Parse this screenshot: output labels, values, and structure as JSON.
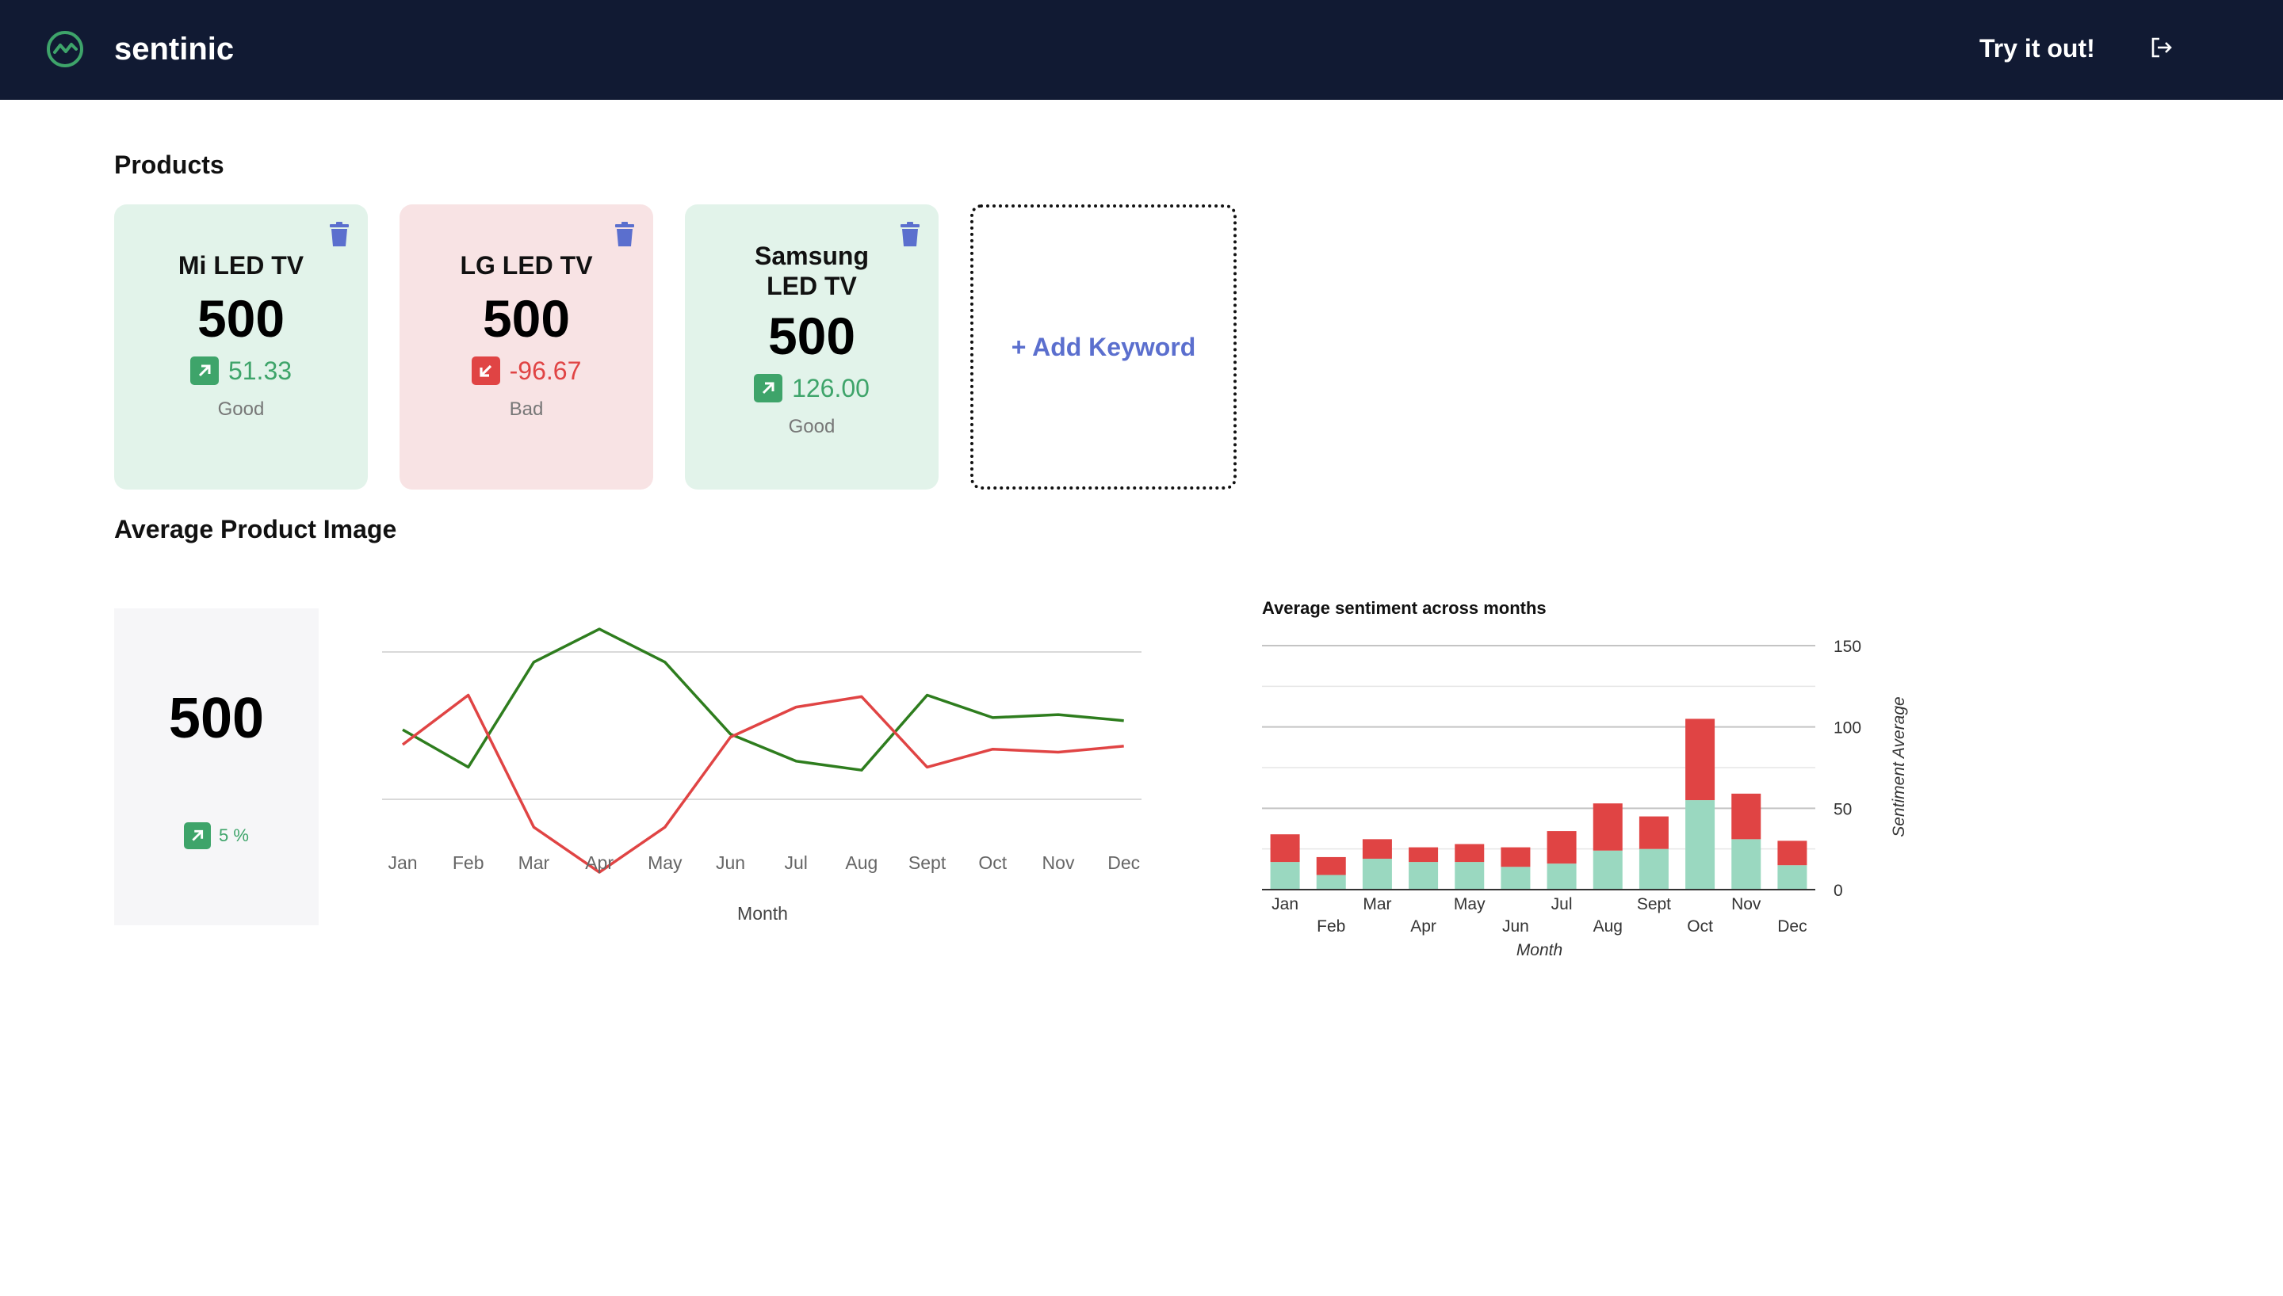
{
  "header": {
    "brand": "sentinic",
    "try_label": "Try it out!"
  },
  "products_section": {
    "title": "Products"
  },
  "products": [
    {
      "name": "Mi LED TV",
      "count": "500",
      "change": "51.33",
      "trend": "up",
      "label": "Good",
      "sentiment": "good"
    },
    {
      "name": "LG LED TV",
      "count": "500",
      "change": "-96.67",
      "trend": "down",
      "label": "Bad",
      "sentiment": "bad"
    },
    {
      "name": "Samsung LED TV",
      "count": "500",
      "change": "126.00",
      "trend": "up",
      "label": "Good",
      "sentiment": "good"
    }
  ],
  "add_keyword": {
    "label": "+ Add Keyword"
  },
  "average_section": {
    "title": "Average Product Image",
    "value": "500",
    "change": "5 %"
  },
  "colors": {
    "good_bg": "#e2f3ea",
    "bad_bg": "#f8e3e4",
    "green": "#3ea46a",
    "red": "#e04444",
    "header_bg": "#111a33",
    "accent": "#5b6fce",
    "bar_green": "#9ad8c0",
    "bar_red": "#e04444",
    "line_green": "#2e7d1e"
  },
  "icons": {
    "logo": "trend-circle-icon",
    "logout": "logout-icon",
    "trash": "trash-icon",
    "arrow_up": "arrow-up-right-icon",
    "arrow_down": "arrow-down-left-icon"
  },
  "chart_data": [
    {
      "type": "line",
      "title": "",
      "xlabel": "Month",
      "ylabel": "",
      "categories": [
        "Jan",
        "Feb",
        "Mar",
        "Apr",
        "May",
        "Jun",
        "Jul",
        "Aug",
        "Sept",
        "Oct",
        "Nov",
        "Dec"
      ],
      "series": [
        {
          "color": "#2e7d1e",
          "values": [
            55,
            30,
            100,
            122,
            100,
            52,
            34,
            28,
            78,
            63,
            65,
            61
          ]
        },
        {
          "color": "#e04444",
          "values": [
            45,
            78,
            -10,
            -40,
            -10,
            50,
            70,
            77,
            30,
            42,
            40,
            44
          ]
        }
      ],
      "ylim": [
        -50,
        140
      ],
      "grid": true,
      "legend": "none"
    },
    {
      "type": "bar",
      "stacked": true,
      "title": "Average sentiment across months",
      "xlabel": "Month",
      "ylabel": "Sentiment Average",
      "categories": [
        "Jan",
        "Feb",
        "Mar",
        "Apr",
        "May",
        "Jun",
        "Jul",
        "Aug",
        "Sept",
        "Oct",
        "Nov",
        "Dec"
      ],
      "series": [
        {
          "color": "#9ad8c0",
          "values": [
            17,
            9,
            19,
            17,
            17,
            14,
            16,
            24,
            25,
            55,
            31,
            15
          ]
        },
        {
          "color": "#e04444",
          "values": [
            17,
            11,
            12,
            9,
            11,
            12,
            20,
            29,
            20,
            50,
            28,
            15
          ]
        }
      ],
      "ylim": [
        0,
        150
      ],
      "yticks": [
        0,
        50,
        100,
        150
      ],
      "grid": true,
      "legend": "none"
    }
  ]
}
